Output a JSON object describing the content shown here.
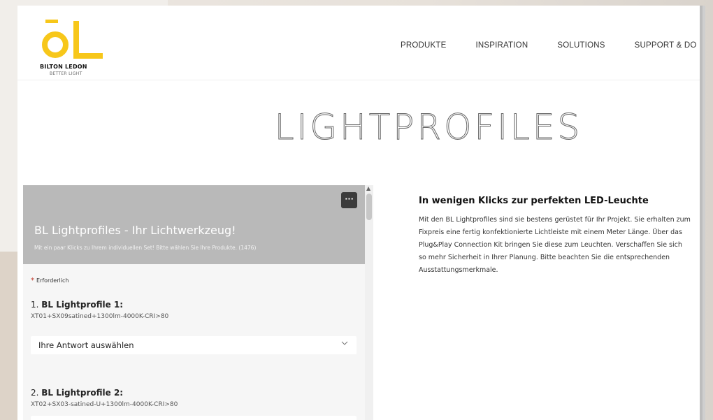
{
  "brand": {
    "name": "BILTON LEDON",
    "tagline": "BETTER LIGHT",
    "accent_color": "#f7c71a"
  },
  "nav": {
    "items": [
      {
        "label": "PRODUKTE"
      },
      {
        "label": "INSPIRATION"
      },
      {
        "label": "SOLUTIONS"
      },
      {
        "label": "SUPPORT & DO"
      }
    ]
  },
  "hero": {
    "title": "LIGHTPROFILES"
  },
  "form": {
    "title": "BL Lightprofiles - Ihr Lichtwerkzeug!",
    "subtitle": "Mit ein paar Klicks zu Ihrem individuellen Set! Bitte wählen Sie Ihre Produkte. (1476)",
    "more_icon": "ellipsis-icon",
    "required_label": "Erforderlich",
    "questions": [
      {
        "number": "1.",
        "label": "BL Lightprofile 1:",
        "desc": "XT01+SX09satined+1300lm-4000K-CRI>80",
        "select_value": "Ihre Antwort auswählen"
      },
      {
        "number": "2.",
        "label": "BL Lightprofile 2:",
        "desc": "XT02+SX03-satined-U+1300lm-4000K-CRI>80",
        "select_value": ""
      }
    ]
  },
  "info": {
    "title": "In wenigen Klicks zur perfekten LED-Leuchte",
    "body": "Mit den BL Lightprofiles sind sie bestens gerüstet für Ihr Projekt. Sie erhalten zum Fixpreis eine fertig konfektionierte Lichtleiste mit einem Meter Länge. Über das Plug&Play Connection Kit bringen Sie diese zum Leuchten. Verschaffen Sie sich so mehr Sicherheit in Ihrer Planung. Bitte beachten Sie die entsprechenden Ausstattungsmerkmale."
  }
}
